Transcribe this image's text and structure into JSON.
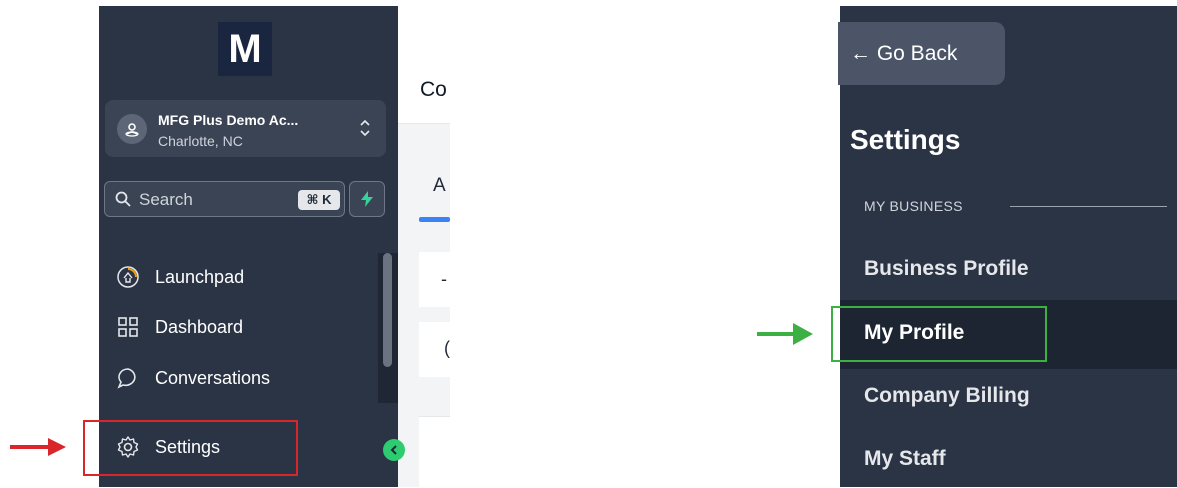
{
  "left_panel": {
    "logo_letter": "M",
    "account": {
      "name": "MFG Plus Demo Ac...",
      "location": "Charlotte, NC"
    },
    "search": {
      "placeholder": "Search",
      "shortcut": "⌘ K"
    },
    "nav_items": [
      {
        "label": "Launchpad",
        "icon": "launchpad-icon"
      },
      {
        "label": "Dashboard",
        "icon": "dashboard-icon"
      },
      {
        "label": "Conversations",
        "icon": "chat-bubble-icon"
      },
      {
        "label": "Settings",
        "icon": "gear-icon"
      }
    ],
    "page_header_partial": "Co",
    "tab_partial": "A",
    "card_1_partial": "-",
    "card_2_partial": "(",
    "colors": {
      "sidebar_bg": "#2b3445",
      "accent_green": "#2ecc71",
      "tab_blue": "#3b82f6",
      "annotation_red": "#d8262a"
    }
  },
  "right_panel": {
    "go_back_label": "← Go Back",
    "heading": "Settings",
    "section_label": "MY BUSINESS",
    "menu_items": [
      {
        "label": "Business Profile",
        "active": false
      },
      {
        "label": "My Profile",
        "active": true
      },
      {
        "label": "Company Billing",
        "active": false
      },
      {
        "label": "My Staff",
        "active": false
      }
    ],
    "colors": {
      "annotation_green": "#3cb043",
      "active_bg": "#1d2533"
    }
  }
}
